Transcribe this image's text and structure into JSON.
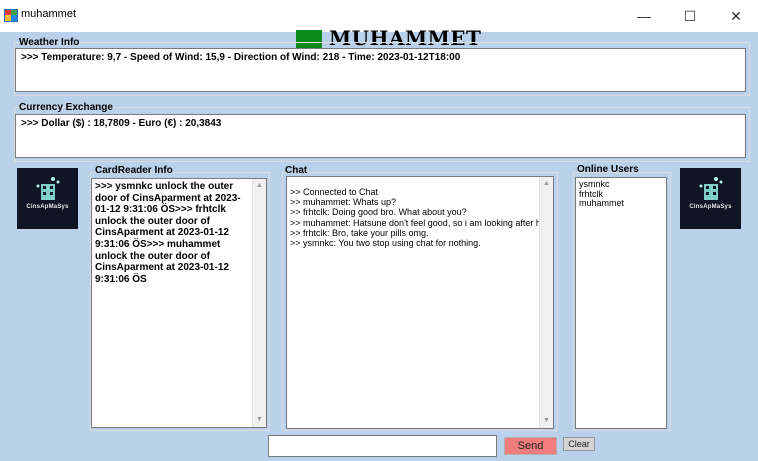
{
  "window": {
    "title": "muhammet",
    "minimize": "—",
    "maximize": "☐",
    "close": "✕"
  },
  "header": {
    "username": "MUHAMMET",
    "status_color": "#0a8a1a"
  },
  "weather": {
    "title": "Weather Info",
    "text": ">>>  Temperature: 9,7 - Speed of Wind: 15,9 - Direction of Wind: 218 - Time: 2023-01-12T18:00"
  },
  "currency": {
    "title": "Currency Exchange",
    "text": ">>> Dollar ($) : 18,7809 - Euro (€) : 20,3843"
  },
  "logo": {
    "text": "CinsApMaSys"
  },
  "cardreader": {
    "title": "CardReader Info",
    "text": ">>> ysmnkc unlock the outer door of CinsAparment at 2023-01-12 9:31:06 ÖS>>> frhtclk unlock the outer door of CinsAparment at 2023-01-12 9:31:06 ÖS>>> muhammet unlock the outer door of CinsAparment at 2023-01-12 9:31:06 ÖS"
  },
  "chat": {
    "title": "Chat",
    "messages": [
      ">> Connected to Chat",
      ">> muhammet: Whats up?",
      ">> frhtclk: Doing good bro. What about you?",
      ">> muhammet: Hatsune don't feel good, so i am looking after her.",
      ">> frhtclk: Bro, take your pills omg.",
      ">> ysmnkc: You two stop using chat for nothing."
    ]
  },
  "online_users": {
    "title": "Online Users",
    "users": [
      "ysmnkc",
      "frhtclk",
      "muhammet"
    ]
  },
  "footer": {
    "message_value": "",
    "send_label": "Send",
    "clear_label": "Clear",
    "send_color": "#f17c7c"
  }
}
